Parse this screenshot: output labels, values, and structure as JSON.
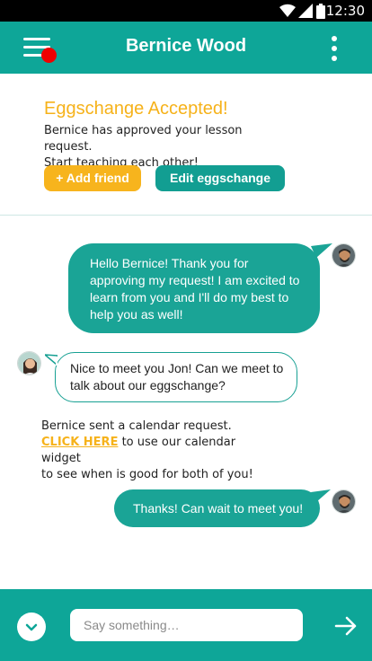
{
  "status_bar": {
    "time": "12:30",
    "icons": [
      "wifi-icon",
      "signal-icon",
      "battery-icon"
    ]
  },
  "header": {
    "title": "Bernice Wood",
    "menu_icon": "hamburger-menu-icon",
    "notification_dot_color": "#ef0000",
    "more_icon": "more-vertical-icon"
  },
  "accept_card": {
    "title": "Eggschange Accepted!",
    "message_line1": "Bernice has approved your lesson request.",
    "message_line2": "Start teaching each other!",
    "add_friend_label": "+ Add friend",
    "edit_label": "Edit eggschange"
  },
  "messages": [
    {
      "from": "me",
      "text": "Hello Bernice! Thank you for approving my request! I am excited to learn from you and I'll do my best to help you as well!"
    },
    {
      "from": "Bernice",
      "text": "Nice to meet you Jon! Can we meet to talk about our eggschange?"
    },
    {
      "from": "me",
      "text": "Thanks! Can wait to meet you!"
    }
  ],
  "calendar_note": {
    "line1": "Bernice sent a calendar request.",
    "link_text": "CLICK HERE",
    "line2_rest": " to use our calendar widget",
    "line3": "to see when is good for both of you!"
  },
  "input_bar": {
    "placeholder": "Say something…",
    "expand_icon": "chevron-down-icon",
    "send_icon": "arrow-right-icon"
  },
  "colors": {
    "primary": "#0ea698",
    "accent": "#f6b21a",
    "bubble": "#1aa496"
  }
}
